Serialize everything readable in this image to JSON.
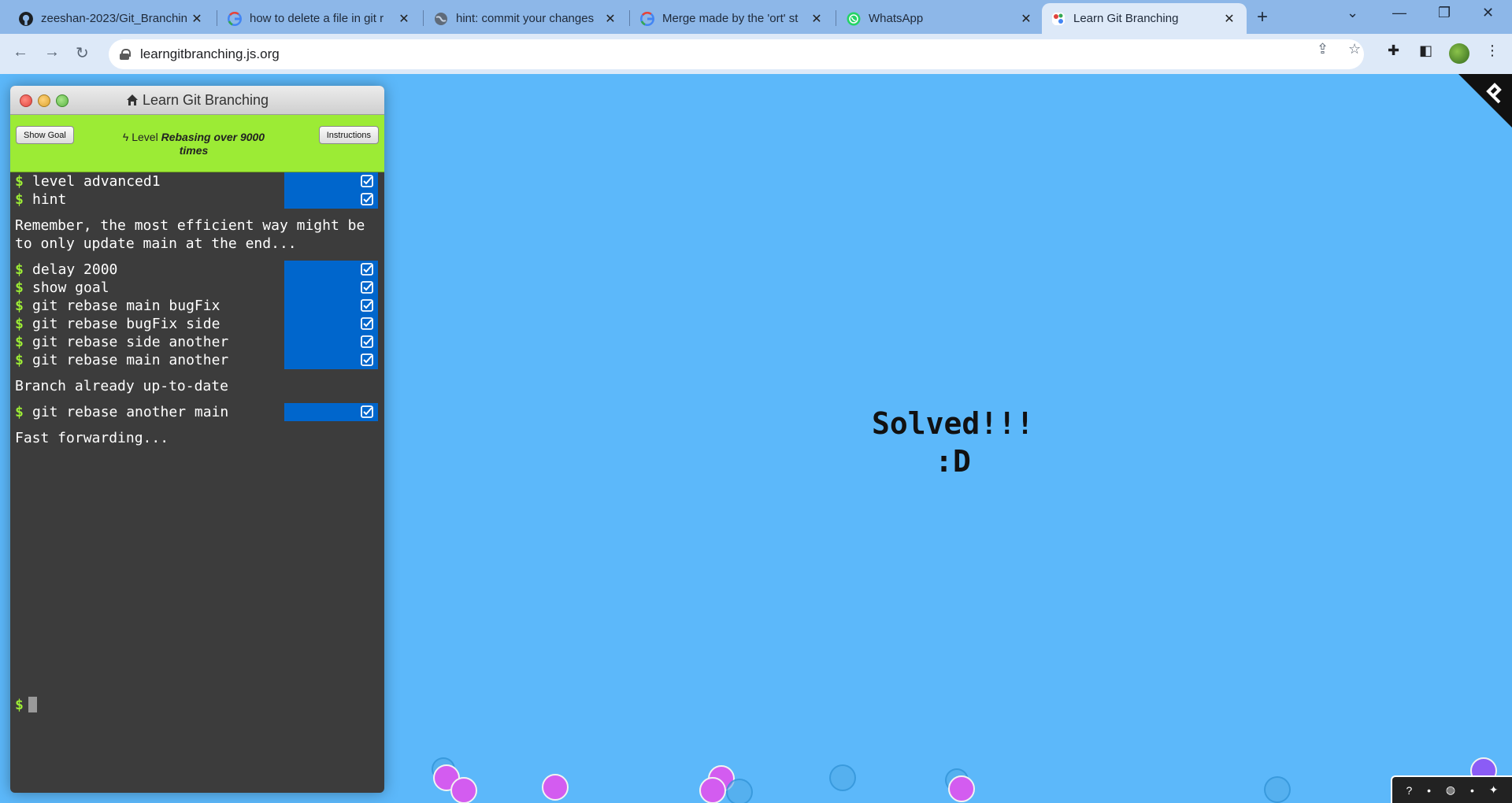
{
  "browser": {
    "tabs": [
      {
        "title": "zeeshan-2023/Git_Branchin",
        "favicon": "github-icon",
        "active": false
      },
      {
        "title": "how to delete a file in git r",
        "favicon": "google-icon",
        "active": false
      },
      {
        "title": "hint: commit your changes",
        "favicon": "globe-icon",
        "active": false
      },
      {
        "title": "Merge made by the 'ort' st",
        "favicon": "google-icon",
        "active": false
      },
      {
        "title": "WhatsApp",
        "favicon": "whatsapp-icon",
        "active": false
      },
      {
        "title": "Learn Git Branching",
        "favicon": "git-branching-icon",
        "active": true
      }
    ],
    "url": "learngitbranching.js.org"
  },
  "terminal": {
    "title": "Learn Git Branching",
    "show_goal_label": "Show Goal",
    "instructions_label": "Instructions",
    "level_prefix": "Level",
    "level_name": "Rebasing over 9000 times",
    "commands_a": [
      "level advanced1",
      "hint"
    ],
    "hint_output": "Remember, the most efficient way might be to only update main at the end...",
    "commands_b": [
      "delay 2000",
      "show goal",
      "git rebase main bugFix",
      "git rebase bugFix side",
      "git rebase side another",
      "git rebase main another"
    ],
    "output_b": "Branch already up-to-date",
    "commands_c": [
      "git rebase another main"
    ],
    "output_c": "Fast forwarding...",
    "prompt_symbol": "$"
  },
  "canvas": {
    "message_line1": "Solved!!!",
    "message_line2": ":D"
  },
  "colors": {
    "canvas_bg": "#5cb8fa",
    "level_bar": "#9ceb35",
    "command_done": "#0066cc",
    "node_purple": "#d35cf0"
  }
}
